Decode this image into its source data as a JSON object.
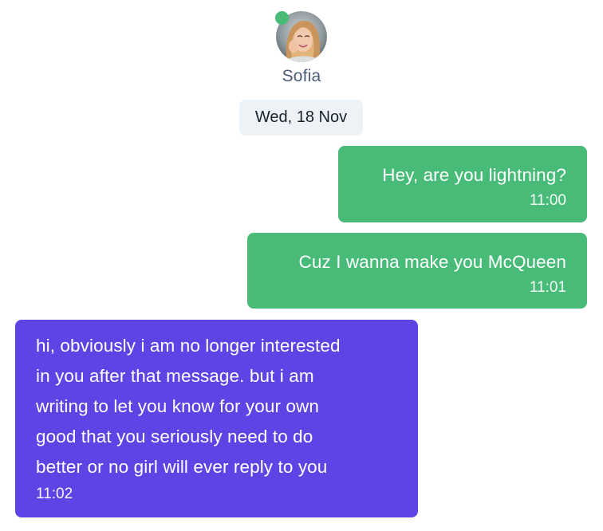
{
  "contact": {
    "name": "Sofia",
    "online": true,
    "avatar_icon": "user-avatar-photo",
    "online_color": "#48bb78"
  },
  "date_separator": "Wed, 18 Nov",
  "messages": [
    {
      "direction": "sent",
      "text": "Hey, are you lightning?",
      "time": "11:00",
      "color": "#48bb78"
    },
    {
      "direction": "sent",
      "text": "Cuz I wanna make you McQueen",
      "time": "11:01",
      "color": "#48bb78"
    },
    {
      "direction": "received",
      "lines": [
        "hi, obviously i am no longer interested",
        "in you after that message. but i am",
        "writing to let you know for your own",
        "good that you seriously need to do",
        "better or no girl will ever reply to you"
      ],
      "time": "11:02",
      "color": "#5f44e5"
    }
  ]
}
